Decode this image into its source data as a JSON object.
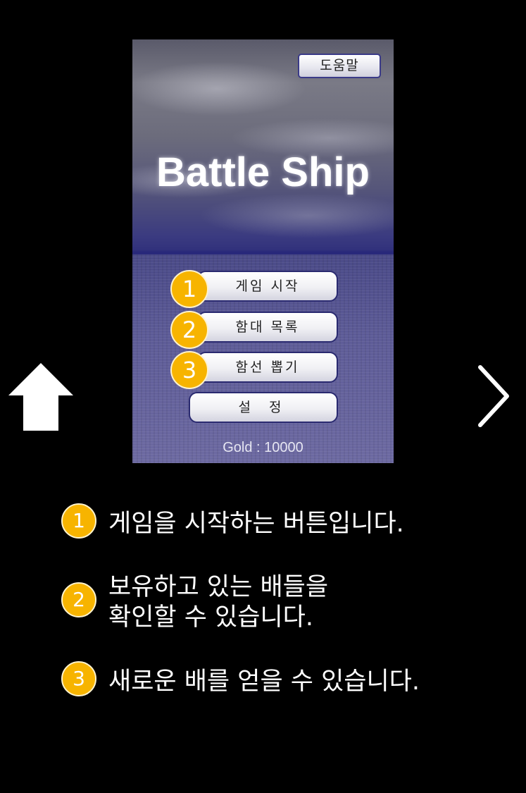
{
  "screen": {
    "help_label": "도움말",
    "title": "Battle Ship",
    "menu": {
      "start_label": "게임 시작",
      "fleet_label": "함대 목록",
      "draw_label": "함선 뽑기",
      "settings_label": "설 정"
    },
    "gold_text": "Gold : 10000"
  },
  "badges": [
    "1",
    "2",
    "3"
  ],
  "descriptions": [
    {
      "number": "1",
      "lines": [
        "게임을 시작하는 버튼입니다."
      ]
    },
    {
      "number": "2",
      "lines": [
        "보유하고 있는 배들을",
        "확인할 수 있습니다."
      ]
    },
    {
      "number": "3",
      "lines": [
        "새로운 배를 얻을 수 있습니다."
      ]
    }
  ],
  "colors": {
    "badge": "#f7b400",
    "background": "#000000",
    "text": "#ffffff"
  },
  "icons": {
    "up": "up-arrow-icon",
    "next": "chevron-right-icon"
  }
}
